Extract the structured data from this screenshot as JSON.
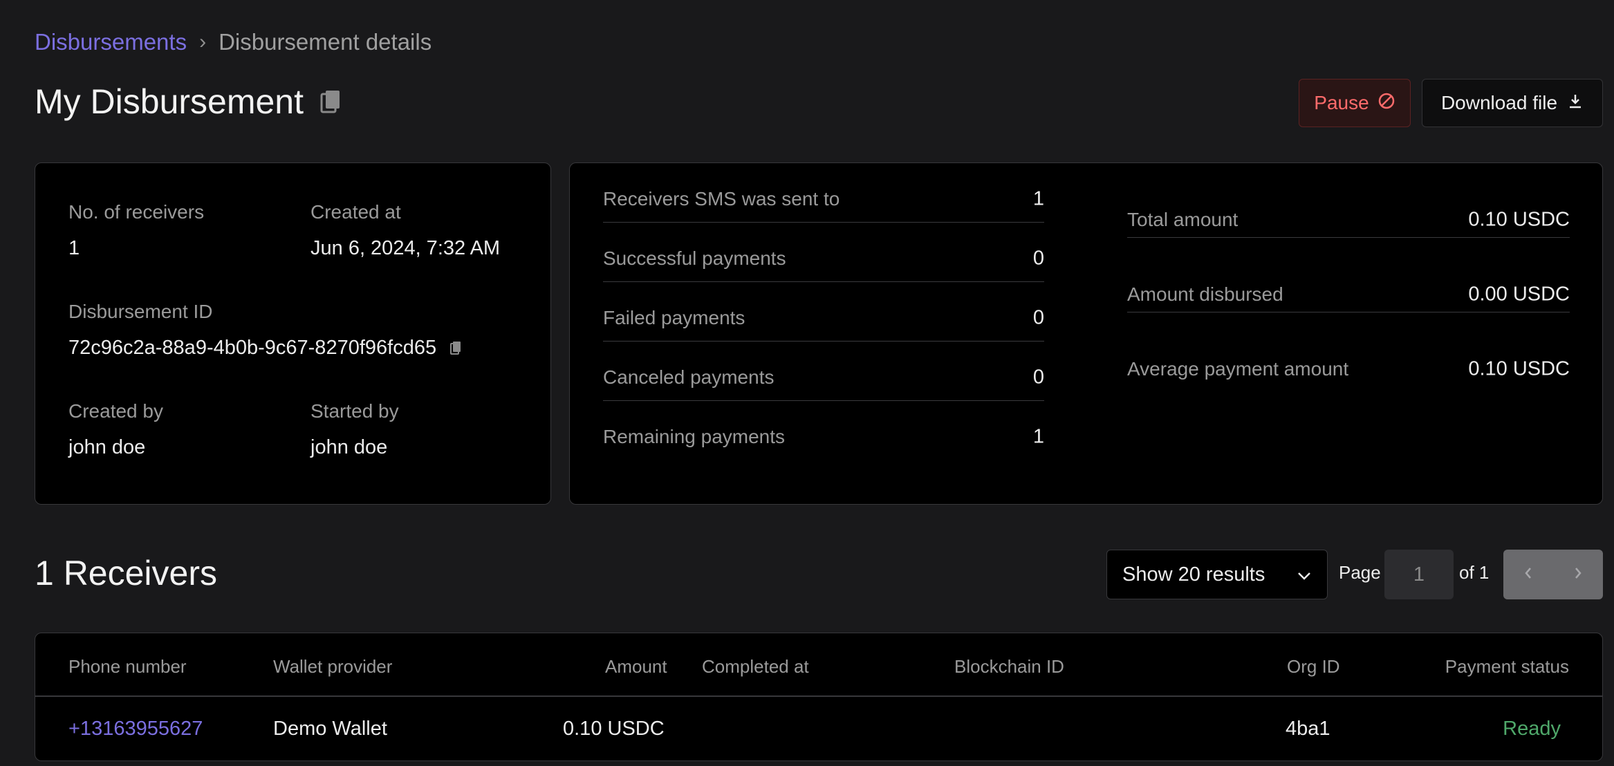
{
  "breadcrumb": {
    "parent": "Disbursements",
    "separator": "›",
    "current": "Disbursement details"
  },
  "header": {
    "title": "My Disbursement",
    "pause_label": "Pause",
    "download_label": "Download file"
  },
  "details": {
    "receivers_label": "No. of receivers",
    "receivers_value": "1",
    "created_at_label": "Created at",
    "created_at_value": "Jun 6, 2024, 7:32 AM",
    "id_label": "Disbursement ID",
    "id_value": "72c96c2a-88a9-4b0b-9c67-8270f96fcd65",
    "created_by_label": "Created by",
    "created_by_value": "john doe",
    "started_by_label": "Started by",
    "started_by_value": "john doe"
  },
  "stats": [
    {
      "label": "Receivers SMS was sent to",
      "value": "1"
    },
    {
      "label": "Successful payments",
      "value": "0"
    },
    {
      "label": "Failed payments",
      "value": "0"
    },
    {
      "label": "Canceled payments",
      "value": "0"
    },
    {
      "label": "Remaining payments",
      "value": "1"
    }
  ],
  "summary": [
    {
      "label": "Total amount",
      "value": "0.10 USDC"
    },
    {
      "label": "Amount disbursed",
      "value": "0.00 USDC"
    },
    {
      "label": "Average payment amount",
      "value": "0.10 USDC"
    }
  ],
  "receivers": {
    "title": "1 Receivers",
    "page_size_label": "Show 20 results",
    "page_label": "Page",
    "page_value": "1",
    "of_label": "of 1"
  },
  "table": {
    "columns": {
      "phone": "Phone number",
      "wallet": "Wallet provider",
      "amount": "Amount",
      "completed": "Completed at",
      "blockchain": "Blockchain ID",
      "org": "Org ID",
      "status": "Payment status"
    },
    "rows": [
      {
        "phone": "+13163955627",
        "wallet": "Demo Wallet",
        "amount": "0.10 USDC",
        "completed": "",
        "blockchain": "",
        "org": "4ba1",
        "status": "Ready"
      }
    ]
  },
  "colors": {
    "accent": "#7b6fe0",
    "danger": "#ff6b6b",
    "success": "#4fa86a",
    "background": "#19191b",
    "card": "#000000"
  },
  "icons": {
    "title_copy": "copy-icon",
    "id_copy": "copy-icon",
    "pause": "ban-icon",
    "download": "download-icon",
    "select": "chevron-down-icon",
    "prev": "chevron-left-icon",
    "next": "chevron-right-icon"
  }
}
